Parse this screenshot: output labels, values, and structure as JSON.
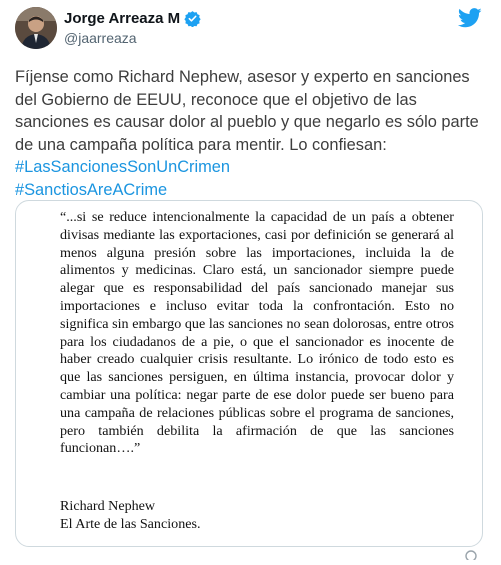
{
  "author": {
    "name": "Jorge Arreaza M",
    "handle": "@jaarreaza",
    "verified_icon": "verified-badge-icon",
    "avatar_icon": "avatar-photo"
  },
  "brand": {
    "icon": "twitter-bird-icon",
    "color": "#1da1f2"
  },
  "tweet": {
    "text": "Fíjense como Richard Nephew, asesor y experto en sanciones del Gobierno de EEUU, reconoce que el objetivo de las sanciones es causar dolor al pueblo y que negarlo es sólo parte de una campaña política para mentir.  Lo confiesan:",
    "hashtags": [
      "#LasSancionesSonUnCrimen",
      "#SanctiosAreACrime"
    ],
    "hashtag_color": "#1b95e0"
  },
  "media": {
    "quote": "“...si se reduce intencionalmente la capacidad de un país a obtener divisas mediante las exportaciones, casi por definición se generará al menos alguna presión sobre las importaciones, incluida la de alimentos y medicinas. Claro está, un sancionador siempre puede alegar que es responsabilidad del país sancionado manejar sus importaciones e incluso evitar toda la confrontación. Esto no significa sin embargo que las sanciones no sean dolorosas, entre otros para los ciudadanos de a pie, o que el sancionador es inocente de haber creado cualquier crisis resultante. Lo irónico de todo esto es que las sanciones persiguen, en última instancia, provocar dolor y cambiar una política: negar parte de ese dolor puede ser bueno para una campaña de relaciones públicas sobre el programa de sanciones, pero también debilita la afirmación de que las sanciones funcionan….”",
    "author": "Richard Nephew",
    "source": "El Arte de las Sanciones."
  }
}
